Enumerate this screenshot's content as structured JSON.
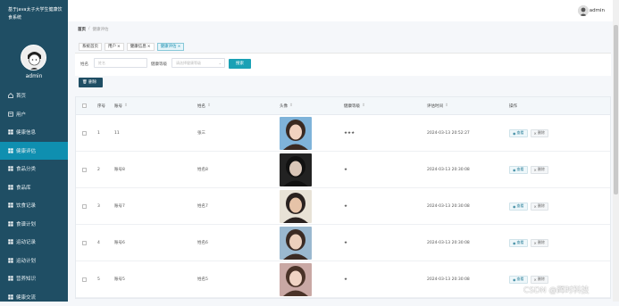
{
  "sidebar": {
    "brand": "基于java太子大学生健康饮食系统",
    "username": "admin",
    "items": [
      {
        "label": "首页",
        "icon": "home-icon"
      },
      {
        "label": "用户",
        "icon": "user-icon"
      },
      {
        "label": "健康信息",
        "icon": "grid-icon"
      },
      {
        "label": "健康评估",
        "icon": "grid-icon"
      },
      {
        "label": "食品分类",
        "icon": "grid-icon"
      },
      {
        "label": "食品库",
        "icon": "grid-icon"
      },
      {
        "label": "饮食记录",
        "icon": "grid-icon"
      },
      {
        "label": "食谱计划",
        "icon": "grid-icon"
      },
      {
        "label": "运动记录",
        "icon": "grid-icon"
      },
      {
        "label": "运动计划",
        "icon": "grid-icon"
      },
      {
        "label": "营养知识",
        "icon": "grid-icon"
      },
      {
        "label": "健康交流",
        "icon": "grid-icon"
      }
    ],
    "active_index": 3
  },
  "topbar": {
    "username": "admin"
  },
  "breadcrumb": {
    "home": "首页",
    "current": "健康评估"
  },
  "tabs": [
    {
      "label": "系统首页",
      "closable": false
    },
    {
      "label": "用户",
      "closable": true
    },
    {
      "label": "健康信息",
      "closable": true
    },
    {
      "label": "健康评估",
      "closable": true
    }
  ],
  "filter": {
    "name_label": "姓名",
    "name_placeholder": "姓名",
    "grade_label": "健康等级",
    "grade_placeholder": "请选择健康等级",
    "search_label": "搜索"
  },
  "delete_label": "删除",
  "table": {
    "headers": {
      "index": "序号",
      "account": "账号",
      "name": "姓名",
      "avatar": "头像",
      "grade": "健康等级",
      "time": "评估时间",
      "action": "操作"
    },
    "view_label": "查看",
    "delete_label": "删除",
    "rows": [
      {
        "index": "1",
        "account": "11",
        "name": "张三",
        "grade": "★★★",
        "time": "2024-03-13 20:52:27"
      },
      {
        "index": "2",
        "account": "账号8",
        "name": "姓名8",
        "grade": "★",
        "time": "2024-03-13 20:30:08"
      },
      {
        "index": "3",
        "account": "账号7",
        "name": "姓名7",
        "grade": "★",
        "time": "2024-03-13 20:30:08"
      },
      {
        "index": "4",
        "account": "账号6",
        "name": "姓名6",
        "grade": "★",
        "time": "2024-03-13 20:30:08"
      },
      {
        "index": "5",
        "account": "账号5",
        "name": "姓名5",
        "grade": "★",
        "time": "2024-03-13 20:30:08"
      }
    ]
  },
  "watermark": "CSDN @辉时科技"
}
